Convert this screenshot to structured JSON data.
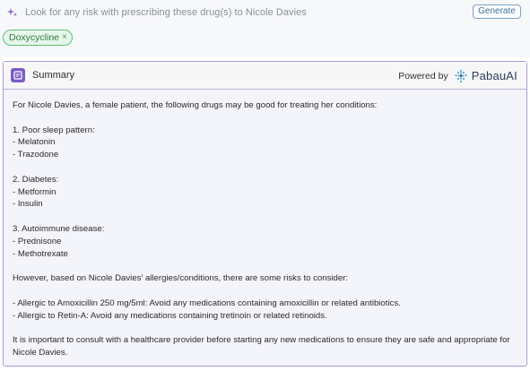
{
  "prompt": {
    "text": "Look for any risk with prescribing these drug(s) to Nicole Davies",
    "icon": "sparkle-icon",
    "generate_label": "Generate"
  },
  "chips": [
    {
      "label": "Doxycycline",
      "remove": "×"
    }
  ],
  "summary": {
    "title": "Summary",
    "powered_by": "Powered by",
    "brand": "PabauAI",
    "intro": "For Nicole Davies, a female patient, the following drugs may be good for treating her conditions:",
    "sections": [
      {
        "heading": "1. Poor sleep pattern:",
        "items": [
          "- Melatonin",
          "- Trazodone"
        ]
      },
      {
        "heading": "2. Diabetes:",
        "items": [
          "- Metformin",
          "- Insulin"
        ]
      },
      {
        "heading": "3. Autoimmune disease:",
        "items": [
          "- Prednisone",
          "- Methotrexate"
        ]
      }
    ],
    "risks_intro": "However, based on Nicole Davies' allergies/conditions, there are some risks to consider:",
    "risks": [
      "- Allergic to Amoxicillin 250 mg/5ml: Avoid any medications containing amoxicillin or related antibiotics.",
      "- Allergic to Retin-A: Avoid any medications containing tretinoin or related retinoids."
    ],
    "closing": "It is important to consult with a healthcare provider before starting any new medications to ensure they are safe and appropriate for Nicole Davies."
  },
  "colors": {
    "accent": "#7b5cc6",
    "card_border": "#a89bd8",
    "chip_green": "#5cc07a",
    "button_blue": "#7aa0c4"
  }
}
